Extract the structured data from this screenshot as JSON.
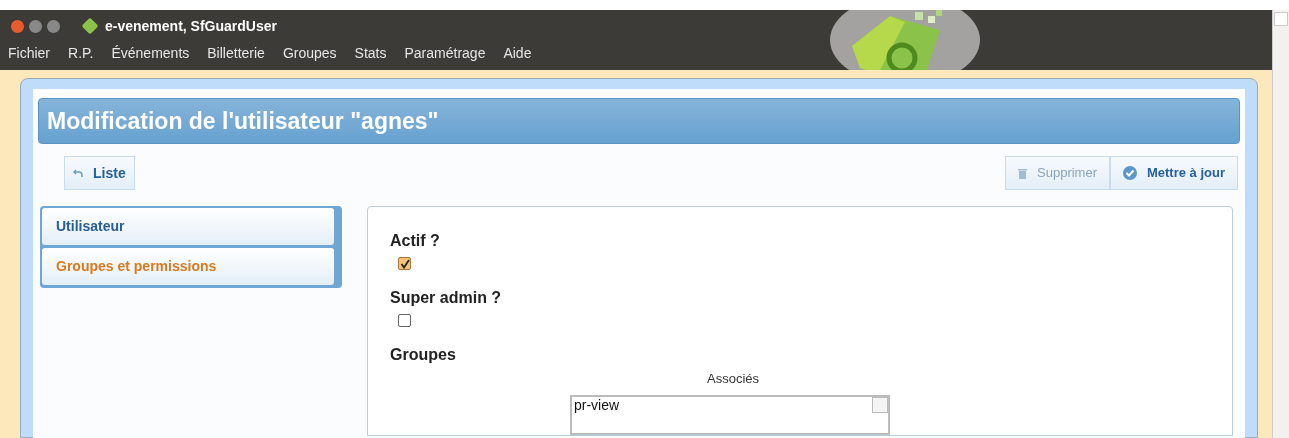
{
  "window": {
    "title": "e-venement, SfGuardUser"
  },
  "menu": [
    "Fichier",
    "R.P.",
    "Événements",
    "Billetterie",
    "Groupes",
    "Stats",
    "Paramétrage",
    "Aide"
  ],
  "page_title": "Modification de l'utilisateur \"agnes\"",
  "back_button": "Liste",
  "actions": [
    {
      "label": "Supprimer",
      "kind": "delete",
      "disabled": true
    },
    {
      "label": "Mettre à jour",
      "kind": "save",
      "disabled": false
    }
  ],
  "tabs": [
    {
      "label": "Utilisateur",
      "selected": false
    },
    {
      "label": "Groupes et permissions",
      "selected": true
    }
  ],
  "fields": [
    {
      "label": "Actif ?",
      "checked": true
    },
    {
      "label": "Super admin ?",
      "checked": false
    }
  ],
  "groups": {
    "label": "Groupes",
    "list_title": "Associés",
    "items": [
      "pr-view"
    ]
  }
}
